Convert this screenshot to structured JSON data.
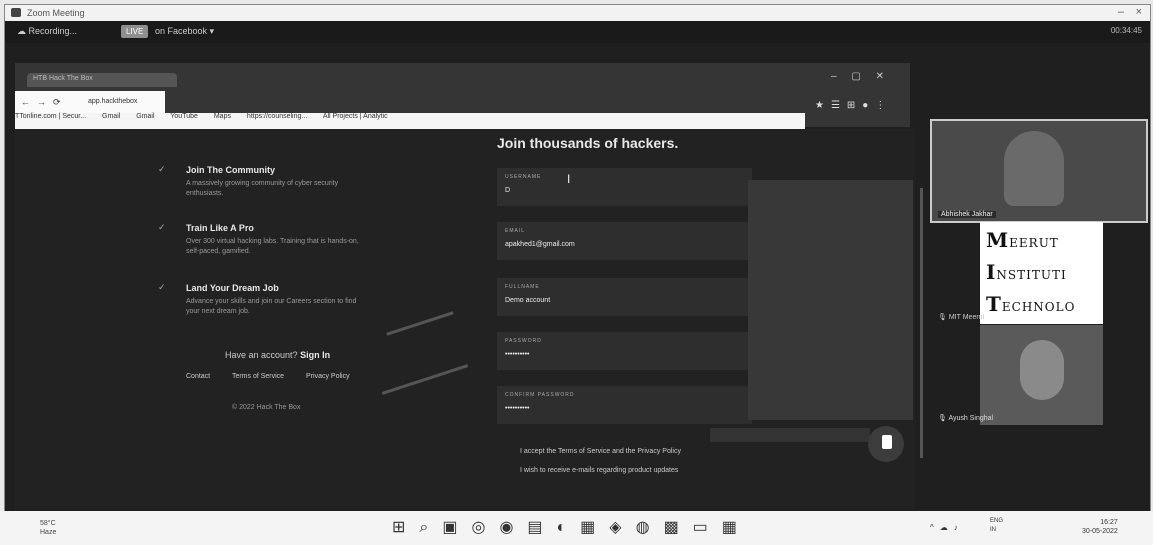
{
  "window": {
    "title": "Zoom Meeting"
  },
  "topbar": {
    "recording": "Recording...",
    "live_badge": "LIVE",
    "live_target": "on Facebook ▾",
    "timer": "00:34:45"
  },
  "browser": {
    "tab_title": "HTB Hack The Box",
    "address": "app.hackthebox",
    "bookmarks": [
      "TTonline.com | Secur...",
      "Gmail",
      "Gmail",
      "YouTube",
      "Maps",
      "https://counseling...",
      "All Projects | Analytic"
    ]
  },
  "page": {
    "heading": "Join thousands of hackers.",
    "features": [
      {
        "title": "Join The Community",
        "desc": "A massively growing community of cyber security enthusiasts."
      },
      {
        "title": "Train Like A Pro",
        "desc": "Over 300 virtual hacking labs. Training that is hands-on, self-paced, gamified."
      },
      {
        "title": "Land Your Dream Job",
        "desc": "Advance your skills and join our Careers section to find your next dream job."
      }
    ],
    "have_account": "Have an account?",
    "sign_in": "Sign In",
    "links": [
      "Contact",
      "Terms of Service",
      "Privacy Policy"
    ],
    "copyright": "© 2022 Hack The Box",
    "form": {
      "username": {
        "label": "USERNAME",
        "value": "D"
      },
      "email": {
        "label": "EMAIL",
        "value": "apakhed1@gmail.com"
      },
      "fullname": {
        "label": "FULLNAME",
        "value": "Demo account"
      },
      "password": {
        "label": "PASSWORD",
        "value": "••••••••••"
      },
      "confirm": {
        "label": "CONFIRM PASSWORD",
        "value": "••••••••••"
      }
    },
    "accept_terms": "I accept the Terms of Service and the Privacy Policy",
    "receive_emails": "I wish to receive e-mails regarding product updates"
  },
  "participants": {
    "p1": "Abhishek Jakhar",
    "p2": "MIT Meerut",
    "p3": "Ayush Singhal"
  },
  "logo_lines": [
    {
      "initial": "M",
      "rest": "EERUT"
    },
    {
      "initial": "I",
      "rest": "NSTITUTI"
    },
    {
      "initial": "T",
      "rest": "ECHNOLO"
    }
  ],
  "taskbar": {
    "weather": "58°C",
    "weather_sub": "Haze",
    "lang": "ENG",
    "lang_sub": "IN",
    "time": "16:27",
    "date": "30-05-2022"
  },
  "colors": {
    "bg_dark": "#1f1f1f",
    "field_bg": "#2e2e2e",
    "live_badge": "#8f8f8f"
  }
}
